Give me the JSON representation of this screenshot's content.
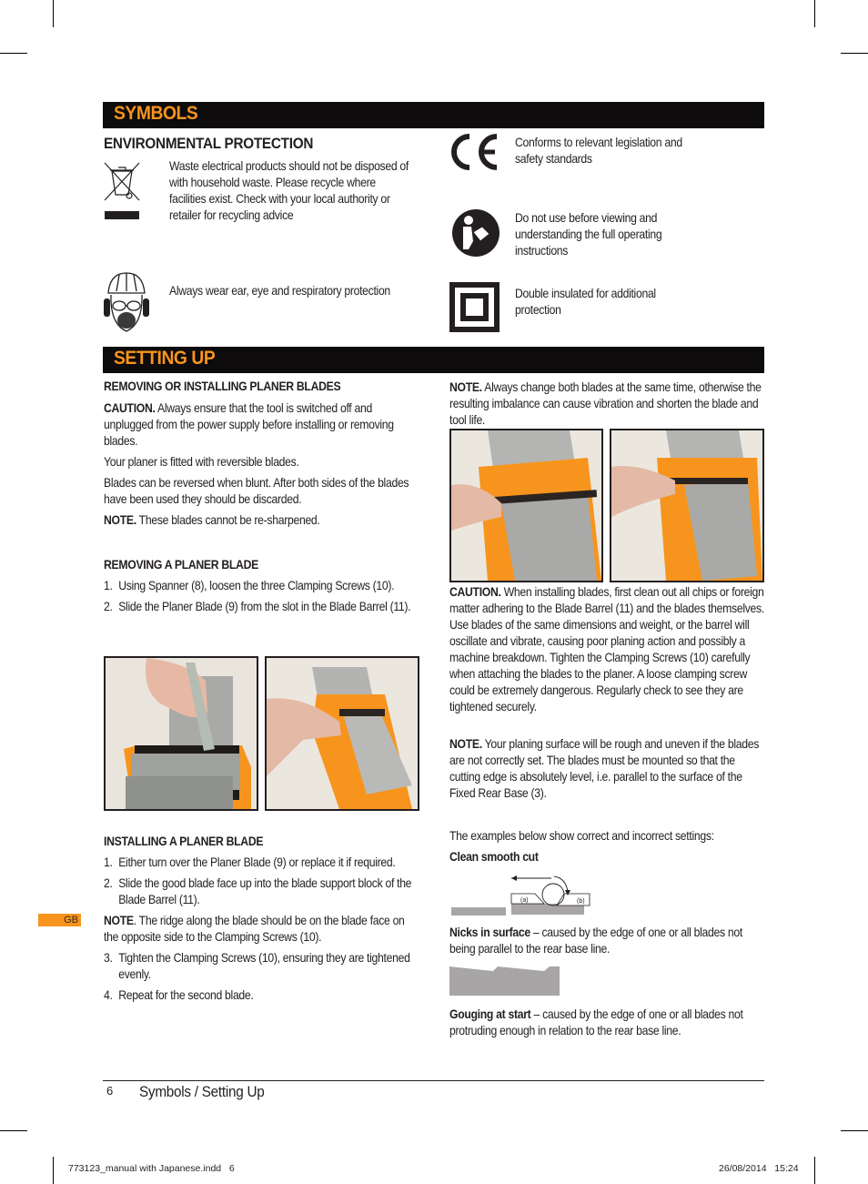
{
  "sections": {
    "symbols": {
      "title": "SYMBOLS",
      "env_heading": "ENVIRONMENTAL PROTECTION",
      "items": [
        {
          "icon": "weee-bin-icon",
          "text": "Waste electrical products should not be disposed of with household waste. Please recycle where facilities exist. Check with your local authority or retailer for  recycling advice"
        },
        {
          "icon": "ppe-head-icon",
          "text": "Always wear ear, eye and respiratory protection"
        },
        {
          "icon": "ce-mark-icon",
          "text": "Conforms to relevant legislation and safety standards"
        },
        {
          "icon": "read-manual-icon",
          "text": "Do not use before viewing and understanding the full operating instructions"
        },
        {
          "icon": "double-insulated-icon",
          "text": "Double insulated for additional protection"
        }
      ]
    },
    "setting_up": {
      "title": "SETTING UP",
      "left": {
        "heading1": "REMOVING OR INSTALLING PLANER BLADES",
        "caution_label": "CAUTION.",
        "caution_text": " Always ensure that the tool is switched off and unplugged from the power supply before installing or removing blades.",
        "para1": "Your planer is fitted with reversible blades.",
        "para2": "Blades can be reversed when blunt. After both sides of the blades have been used they should be discarded.",
        "note_label": "NOTE.",
        "note_text": " These blades cannot be re-sharpened.",
        "heading2": "REMOVING A PLANER BLADE",
        "remove_steps": [
          {
            "n": "1.",
            "text": "Using Spanner (8), loosen the three Clamping Screws (10)."
          },
          {
            "n": "2.",
            "text": "Slide the Planer Blade (9) from the slot in the Blade Barrel (11)."
          }
        ],
        "heading3": "INSTALLING A PLANER BLADE",
        "install_steps_a": [
          {
            "n": "1.",
            "text": "Either turn over the Planer Blade (9) or replace it if required."
          },
          {
            "n": "2.",
            "text": "Slide the good blade face up into the blade support block of the Blade Barrel (11)."
          }
        ],
        "note2_label": "NOTE",
        "note2_text": ". The ridge along the blade should be on the blade face on the opposite side to the Clamping Screws (10).",
        "install_steps_b": [
          {
            "n": "3.",
            "text": "Tighten the Clamping Screws (10), ensuring they are tightened evenly."
          },
          {
            "n": "4.",
            "text": "Repeat for the second blade."
          }
        ]
      },
      "right": {
        "note_label": "NOTE.",
        "note_text": " Always change both blades at the same time, otherwise the resulting imbalance can cause vibration and shorten the blade and tool life.",
        "caution_label": "CAUTION.",
        "caution_text": " When installing blades, first clean out all chips or foreign matter adhering to the Blade Barrel (11) and the blades themselves. Use blades of the same dimensions and weight, or the barrel will oscillate and vibrate, causing poor planing action and possibly a machine breakdown. Tighten the Clamping Screws (10) carefully when attaching the blades to the planer. A loose clamping screw could be extremely dangerous. Regularly check to see they are tightened securely.",
        "note2_label": "NOTE.",
        "note2_text": " Your planing surface will be rough and uneven if the blades are not correctly set. The blades must be mounted so that the cutting edge is absolutely level, i.e. parallel to the surface of the Fixed Rear Base (3).",
        "examples_intro": "The examples below show correct and incorrect settings:",
        "clean_label": "Clean smooth cut",
        "diagram_label_a": "(a)",
        "diagram_label_b": "(b)",
        "nicks_label": "Nicks in surface",
        "nicks_text": " – caused by the edge of one or all blades not being parallel to the rear base line.",
        "gouging_label": "Gouging at start",
        "gouging_text": " – caused by the edge of one or all blades not protruding enough in relation to the rear base line."
      }
    }
  },
  "side_tab": "GB",
  "footer": {
    "page_number": "6",
    "section_title": "Symbols / Setting Up",
    "slug_file": "773123_manual with Japanese.indd   6",
    "slug_date": "26/08/2014   15:24"
  },
  "colors": {
    "accent": "#f7941d",
    "bar": "#0d0b0b",
    "text": "#231f20",
    "diagram_grey": "#a7a5a5"
  }
}
